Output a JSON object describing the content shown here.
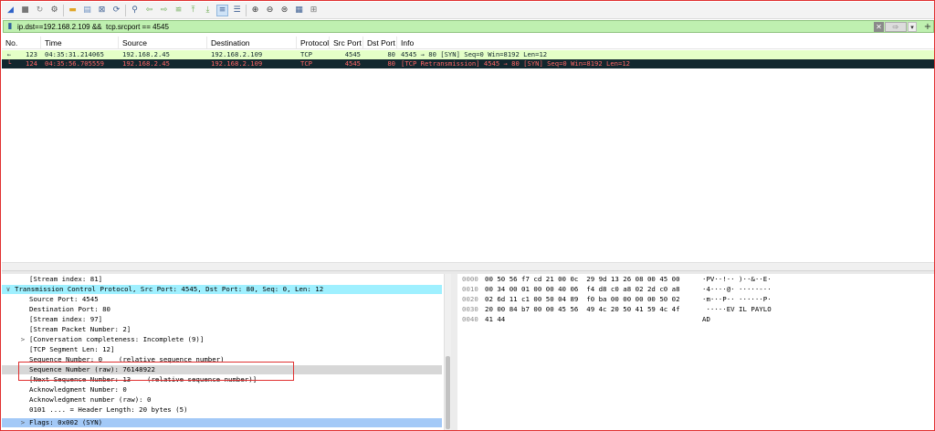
{
  "toolbar": {
    "buttons": [
      "shark-fin-start-icon",
      "stop-icon",
      "restart-icon",
      "gear-icon",
      "sep",
      "folder-open-icon",
      "file-save-icon",
      "file-close-icon",
      "reload-icon",
      "sep",
      "search-icon",
      "back-arrow-icon",
      "forward-arrow-icon",
      "goto-packet-icon",
      "first-packet-icon",
      "last-packet-icon",
      "autoscroll-icon",
      "colorize-icon",
      "sep",
      "zoom-in-icon",
      "zoom-out-icon",
      "zoom-normal-icon",
      "resize-columns-icon",
      "layout-icon"
    ]
  },
  "filter": {
    "text": "ip.dst==192.168.2.109 &&  tcp.srcport == 4545",
    "clear_symbol": "✕",
    "apply_symbol": "⇨",
    "dropdown_symbol": "▾",
    "add_symbol": "+"
  },
  "packet_list": {
    "columns": [
      "No.",
      "Time",
      "Source",
      "Destination",
      "Protocol",
      "Src Port",
      "Dst Port",
      "Info"
    ],
    "rows": [
      {
        "rel": "←",
        "no": "123",
        "time": "04:35:31.214065",
        "src": "192.168.2.45",
        "dst": "192.168.2.109",
        "proto": "TCP",
        "sport": "4545",
        "dport": "80",
        "info": "4545 → 80 [SYN] Seq=0 Win=8192 Len=12"
      },
      {
        "rel": "└",
        "no": "124",
        "time": "04:35:56.705559",
        "src": "192.168.2.45",
        "dst": "192.168.2.109",
        "proto": "TCP",
        "sport": "4545",
        "dport": "80",
        "info": "[TCP Retransmission] 4545 → 80 [SYN] Seq=0 Win=8192 Len=12"
      }
    ]
  },
  "details": {
    "rows": [
      {
        "indent": "",
        "text": "[Stream index: 81]",
        "style": ""
      },
      {
        "indent": "∨",
        "text": "Transmission Control Protocol, Src Port: 4545, Dst Port: 80, Seq: 0, Len: 12",
        "style": "hl"
      },
      {
        "indent": "",
        "text": "Source Port: 4545",
        "style": ""
      },
      {
        "indent": "",
        "text": "Destination Port: 80",
        "style": ""
      },
      {
        "indent": "",
        "text": "[Stream index: 97]",
        "style": ""
      },
      {
        "indent": "",
        "text": "[Stream Packet Number: 2]",
        "style": ""
      },
      {
        "indent": ">",
        "text": "[Conversation completeness: Incomplete (9)]",
        "style": ""
      },
      {
        "indent": "",
        "text": "[TCP Segment Len: 12]",
        "style": ""
      },
      {
        "indent": "",
        "text": "Sequence Number: 0    (relative sequence number)",
        "style": ""
      },
      {
        "indent": "",
        "text": "Sequence Number (raw): 76148922",
        "style": "sel"
      },
      {
        "indent": "",
        "text": "[Next Sequence Number: 13    (relative sequence number)]",
        "style": ""
      },
      {
        "indent": "",
        "text": "Acknowledgment Number: 0",
        "style": ""
      },
      {
        "indent": "",
        "text": "Acknowledgment number (raw): 0",
        "style": ""
      },
      {
        "indent": "",
        "text": "0101 .... = Header Length: 20 bytes (5)",
        "style": ""
      },
      {
        "indent": ">",
        "text": "Flags: 0x002 (SYN)",
        "style": "sel2"
      }
    ]
  },
  "bytes": {
    "rows": [
      {
        "offset": "0000",
        "hex": "00 50 56 f7 cd 21 00 0c  29 9d 13 26 08 00 45 00",
        "ascii": "·PV··!·· )··&··E·"
      },
      {
        "offset": "0010",
        "hex": "00 34 00 01 00 00 40 06  f4 d8 c0 a8 02 2d c0 a8",
        "ascii": "·4····@· ·····-··"
      },
      {
        "offset": "0020",
        "hex": "02 6d 11 c1 00 50 04 89  f0 ba 00 00 00 00 50 02",
        "ascii": "·m···P·· ······P·"
      },
      {
        "offset": "0030",
        "hex": "20 00 84 b7 00 00 45 56  49 4c 20 50 41 59 4c 4f",
        "ascii": " ·····EV IL PAYLO"
      },
      {
        "offset": "0040",
        "hex": "41 44",
        "ascii": "AD"
      }
    ]
  }
}
